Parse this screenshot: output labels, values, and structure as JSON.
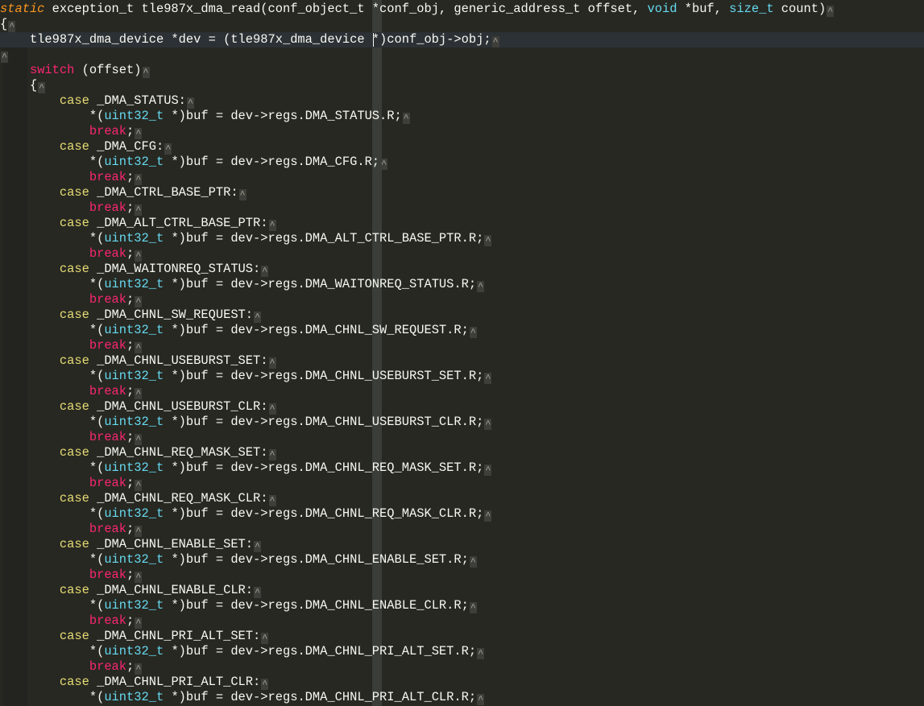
{
  "editor": {
    "eol_marker": "^",
    "colors": {
      "background": "#272822",
      "current_line": "#2c3135",
      "storage": "#fd971f",
      "type": "#66d9ef",
      "keyword": "#f92672",
      "case": "#e6db74",
      "text": "#f8f8f2"
    },
    "lines": [
      {
        "tokens": [
          {
            "t": "static",
            "c": "storage"
          },
          {
            "t": " exception_t tle987x_dma_read(conf_object_t *conf_obj, generic_address_t offset, ",
            "c": "text"
          },
          {
            "t": "void",
            "c": "type"
          },
          {
            "t": " *buf, ",
            "c": "text"
          },
          {
            "t": "size_t",
            "c": "type"
          },
          {
            "t": " count)",
            "c": "text"
          }
        ]
      },
      {
        "tokens": [
          {
            "t": "{",
            "c": "text"
          }
        ]
      },
      {
        "tokens": [
          {
            "t": "    tle987x_dma_device *dev = (tle987x_dma_device *)conf_obj->obj;",
            "c": "text"
          }
        ],
        "current": true
      },
      {
        "tokens": []
      },
      {
        "tokens": [
          {
            "t": "    ",
            "c": "text"
          },
          {
            "t": "switch",
            "c": "keyword"
          },
          {
            "t": " (offset)",
            "c": "text"
          }
        ]
      },
      {
        "tokens": [
          {
            "t": "    {",
            "c": "text"
          }
        ]
      },
      {
        "tokens": [
          {
            "t": "        ",
            "c": "text"
          },
          {
            "t": "case",
            "c": "case"
          },
          {
            "t": " _DMA_STATUS:",
            "c": "text"
          }
        ]
      },
      {
        "tokens": [
          {
            "t": "            *(",
            "c": "text"
          },
          {
            "t": "uint32_t",
            "c": "type"
          },
          {
            "t": " *)buf = dev->regs.DMA_STATUS.R;",
            "c": "text"
          }
        ]
      },
      {
        "tokens": [
          {
            "t": "            ",
            "c": "text"
          },
          {
            "t": "break",
            "c": "keyword"
          },
          {
            "t": ";",
            "c": "text"
          }
        ]
      },
      {
        "tokens": [
          {
            "t": "        ",
            "c": "text"
          },
          {
            "t": "case",
            "c": "case"
          },
          {
            "t": " _DMA_CFG:",
            "c": "text"
          }
        ]
      },
      {
        "tokens": [
          {
            "t": "            *(",
            "c": "text"
          },
          {
            "t": "uint32_t",
            "c": "type"
          },
          {
            "t": " *)buf = dev->regs.DMA_CFG.R;",
            "c": "text"
          }
        ]
      },
      {
        "tokens": [
          {
            "t": "            ",
            "c": "text"
          },
          {
            "t": "break",
            "c": "keyword"
          },
          {
            "t": ";",
            "c": "text"
          }
        ]
      },
      {
        "tokens": [
          {
            "t": "        ",
            "c": "text"
          },
          {
            "t": "case",
            "c": "case"
          },
          {
            "t": " _DMA_CTRL_BASE_PTR:",
            "c": "text"
          }
        ]
      },
      {
        "tokens": [
          {
            "t": "            ",
            "c": "text"
          },
          {
            "t": "break",
            "c": "keyword"
          },
          {
            "t": ";",
            "c": "text"
          }
        ]
      },
      {
        "tokens": [
          {
            "t": "        ",
            "c": "text"
          },
          {
            "t": "case",
            "c": "case"
          },
          {
            "t": " _DMA_ALT_CTRL_BASE_PTR:",
            "c": "text"
          }
        ]
      },
      {
        "tokens": [
          {
            "t": "            *(",
            "c": "text"
          },
          {
            "t": "uint32_t",
            "c": "type"
          },
          {
            "t": " *)buf = dev->regs.DMA_ALT_CTRL_BASE_PTR.R;",
            "c": "text"
          }
        ]
      },
      {
        "tokens": [
          {
            "t": "            ",
            "c": "text"
          },
          {
            "t": "break",
            "c": "keyword"
          },
          {
            "t": ";",
            "c": "text"
          }
        ]
      },
      {
        "tokens": [
          {
            "t": "        ",
            "c": "text"
          },
          {
            "t": "case",
            "c": "case"
          },
          {
            "t": " _DMA_WAITONREQ_STATUS:",
            "c": "text"
          }
        ]
      },
      {
        "tokens": [
          {
            "t": "            *(",
            "c": "text"
          },
          {
            "t": "uint32_t",
            "c": "type"
          },
          {
            "t": " *)buf = dev->regs.DMA_WAITONREQ_STATUS.R;",
            "c": "text"
          }
        ]
      },
      {
        "tokens": [
          {
            "t": "            ",
            "c": "text"
          },
          {
            "t": "break",
            "c": "keyword"
          },
          {
            "t": ";",
            "c": "text"
          }
        ]
      },
      {
        "tokens": [
          {
            "t": "        ",
            "c": "text"
          },
          {
            "t": "case",
            "c": "case"
          },
          {
            "t": " _DMA_CHNL_SW_REQUEST:",
            "c": "text"
          }
        ]
      },
      {
        "tokens": [
          {
            "t": "            *(",
            "c": "text"
          },
          {
            "t": "uint32_t",
            "c": "type"
          },
          {
            "t": " *)buf = dev->regs.DMA_CHNL_SW_REQUEST.R;",
            "c": "text"
          }
        ]
      },
      {
        "tokens": [
          {
            "t": "            ",
            "c": "text"
          },
          {
            "t": "break",
            "c": "keyword"
          },
          {
            "t": ";",
            "c": "text"
          }
        ]
      },
      {
        "tokens": [
          {
            "t": "        ",
            "c": "text"
          },
          {
            "t": "case",
            "c": "case"
          },
          {
            "t": " _DMA_CHNL_USEBURST_SET:",
            "c": "text"
          }
        ]
      },
      {
        "tokens": [
          {
            "t": "            *(",
            "c": "text"
          },
          {
            "t": "uint32_t",
            "c": "type"
          },
          {
            "t": " *)buf = dev->regs.DMA_CHNL_USEBURST_SET.R;",
            "c": "text"
          }
        ]
      },
      {
        "tokens": [
          {
            "t": "            ",
            "c": "text"
          },
          {
            "t": "break",
            "c": "keyword"
          },
          {
            "t": ";",
            "c": "text"
          }
        ]
      },
      {
        "tokens": [
          {
            "t": "        ",
            "c": "text"
          },
          {
            "t": "case",
            "c": "case"
          },
          {
            "t": " _DMA_CHNL_USEBURST_CLR:",
            "c": "text"
          }
        ]
      },
      {
        "tokens": [
          {
            "t": "            *(",
            "c": "text"
          },
          {
            "t": "uint32_t",
            "c": "type"
          },
          {
            "t": " *)buf = dev->regs.DMA_CHNL_USEBURST_CLR.R;",
            "c": "text"
          }
        ]
      },
      {
        "tokens": [
          {
            "t": "            ",
            "c": "text"
          },
          {
            "t": "break",
            "c": "keyword"
          },
          {
            "t": ";",
            "c": "text"
          }
        ]
      },
      {
        "tokens": [
          {
            "t": "        ",
            "c": "text"
          },
          {
            "t": "case",
            "c": "case"
          },
          {
            "t": " _DMA_CHNL_REQ_MASK_SET:",
            "c": "text"
          }
        ]
      },
      {
        "tokens": [
          {
            "t": "            *(",
            "c": "text"
          },
          {
            "t": "uint32_t",
            "c": "type"
          },
          {
            "t": " *)buf = dev->regs.DMA_CHNL_REQ_MASK_SET.R;",
            "c": "text"
          }
        ]
      },
      {
        "tokens": [
          {
            "t": "            ",
            "c": "text"
          },
          {
            "t": "break",
            "c": "keyword"
          },
          {
            "t": ";",
            "c": "text"
          }
        ]
      },
      {
        "tokens": [
          {
            "t": "        ",
            "c": "text"
          },
          {
            "t": "case",
            "c": "case"
          },
          {
            "t": " _DMA_CHNL_REQ_MASK_CLR:",
            "c": "text"
          }
        ]
      },
      {
        "tokens": [
          {
            "t": "            *(",
            "c": "text"
          },
          {
            "t": "uint32_t",
            "c": "type"
          },
          {
            "t": " *)buf = dev->regs.DMA_CHNL_REQ_MASK_CLR.R;",
            "c": "text"
          }
        ]
      },
      {
        "tokens": [
          {
            "t": "            ",
            "c": "text"
          },
          {
            "t": "break",
            "c": "keyword"
          },
          {
            "t": ";",
            "c": "text"
          }
        ]
      },
      {
        "tokens": [
          {
            "t": "        ",
            "c": "text"
          },
          {
            "t": "case",
            "c": "case"
          },
          {
            "t": " _DMA_CHNL_ENABLE_SET:",
            "c": "text"
          }
        ]
      },
      {
        "tokens": [
          {
            "t": "            *(",
            "c": "text"
          },
          {
            "t": "uint32_t",
            "c": "type"
          },
          {
            "t": " *)buf = dev->regs.DMA_CHNL_ENABLE_SET.R;",
            "c": "text"
          }
        ]
      },
      {
        "tokens": [
          {
            "t": "            ",
            "c": "text"
          },
          {
            "t": "break",
            "c": "keyword"
          },
          {
            "t": ";",
            "c": "text"
          }
        ]
      },
      {
        "tokens": [
          {
            "t": "        ",
            "c": "text"
          },
          {
            "t": "case",
            "c": "case"
          },
          {
            "t": " _DMA_CHNL_ENABLE_CLR:",
            "c": "text"
          }
        ]
      },
      {
        "tokens": [
          {
            "t": "            *(",
            "c": "text"
          },
          {
            "t": "uint32_t",
            "c": "type"
          },
          {
            "t": " *)buf = dev->regs.DMA_CHNL_ENABLE_CLR.R;",
            "c": "text"
          }
        ]
      },
      {
        "tokens": [
          {
            "t": "            ",
            "c": "text"
          },
          {
            "t": "break",
            "c": "keyword"
          },
          {
            "t": ";",
            "c": "text"
          }
        ]
      },
      {
        "tokens": [
          {
            "t": "        ",
            "c": "text"
          },
          {
            "t": "case",
            "c": "case"
          },
          {
            "t": " _DMA_CHNL_PRI_ALT_SET:",
            "c": "text"
          }
        ]
      },
      {
        "tokens": [
          {
            "t": "            *(",
            "c": "text"
          },
          {
            "t": "uint32_t",
            "c": "type"
          },
          {
            "t": " *)buf = dev->regs.DMA_CHNL_PRI_ALT_SET.R;",
            "c": "text"
          }
        ]
      },
      {
        "tokens": [
          {
            "t": "            ",
            "c": "text"
          },
          {
            "t": "break",
            "c": "keyword"
          },
          {
            "t": ";",
            "c": "text"
          }
        ]
      },
      {
        "tokens": [
          {
            "t": "        ",
            "c": "text"
          },
          {
            "t": "case",
            "c": "case"
          },
          {
            "t": " _DMA_CHNL_PRI_ALT_CLR:",
            "c": "text"
          }
        ]
      },
      {
        "tokens": [
          {
            "t": "            *(",
            "c": "text"
          },
          {
            "t": "uint32_t",
            "c": "type"
          },
          {
            "t": " *)buf = dev->regs.DMA_CHNL_PRI_ALT_CLR.R;",
            "c": "text"
          }
        ]
      }
    ]
  }
}
